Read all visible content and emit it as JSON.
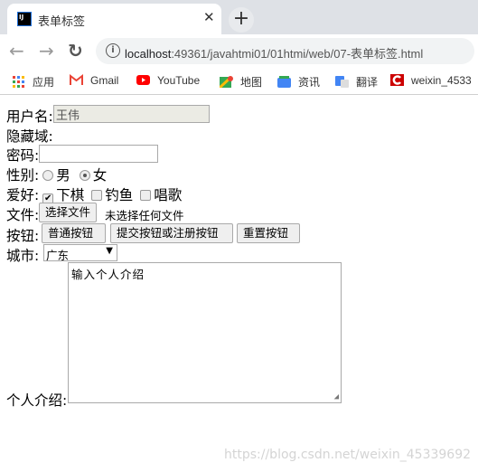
{
  "browser": {
    "tab_title": "表单标签",
    "favicon_text": "IJ",
    "url_host": "localhost",
    "url_rest": ":49361/javahtmi01/01htmi/web/07-表单标签.html",
    "bookmarks": [
      {
        "label": "应用",
        "icon": "apps-grid-icon"
      },
      {
        "label": "Gmail",
        "icon": "gmail-icon"
      },
      {
        "label": "YouTube",
        "icon": "youtube-icon"
      },
      {
        "label": "地图",
        "icon": "maps-icon"
      },
      {
        "label": "资讯",
        "icon": "news-icon"
      },
      {
        "label": "翻译",
        "icon": "translate-icon"
      },
      {
        "label": "weixin_4533",
        "icon": "csdn-icon"
      }
    ]
  },
  "form": {
    "username_label": "用户名:",
    "username_value": "王伟",
    "hidden_label": "隐藏域:",
    "password_label": "密码:",
    "gender_label": "性别:",
    "gender_options": [
      "男",
      "女"
    ],
    "gender_selected": "女",
    "hobby_label": "爱好:",
    "hobbies": [
      {
        "label": "下棋",
        "checked": true
      },
      {
        "label": "钓鱼",
        "checked": false
      },
      {
        "label": "唱歌",
        "checked": false
      }
    ],
    "file_label": "文件:",
    "file_button": "选择文件",
    "file_status": "未选择任何文件",
    "buttons_label": "按钮:",
    "buttons": [
      "普通按钮",
      "提交按钮或注册按钮",
      "重置按钮"
    ],
    "city_label": "城市:",
    "city_value": "广东",
    "intro_label": "个人介绍:",
    "intro_value": "输入个人介绍"
  },
  "watermark": "https://blog.csdn.net/weixin_45339692"
}
